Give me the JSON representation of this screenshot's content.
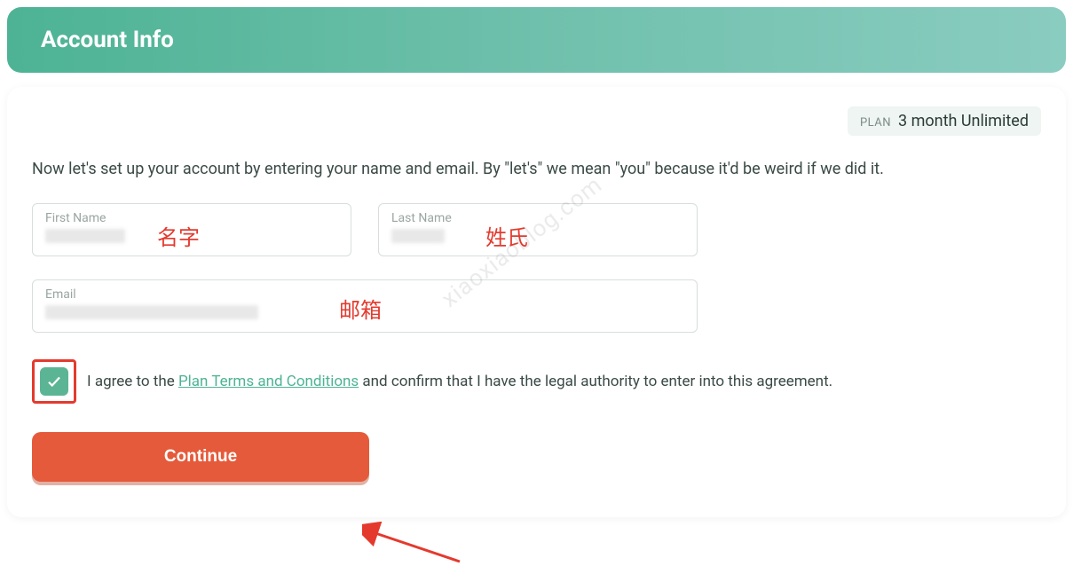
{
  "header": {
    "title": "Account Info"
  },
  "plan": {
    "label": "PLAN",
    "value": "3 month Unlimited"
  },
  "intro": "Now let's set up your account by entering your name and email. By \"let's\" we mean \"you\" because it'd be weird if we did it.",
  "fields": {
    "first_name": {
      "label": "First Name",
      "value": ""
    },
    "last_name": {
      "label": "Last Name",
      "value": ""
    },
    "email": {
      "label": "Email",
      "value": ""
    }
  },
  "annotations": {
    "first_name": "名字",
    "last_name": "姓氏",
    "email": "邮箱"
  },
  "watermark": "xiaoxiaoblog.com",
  "consent": {
    "prefix": "I agree to the ",
    "link": "Plan Terms and Conditions",
    "suffix": " and confirm that I have the legal authority to enter into this agreement.",
    "checked": true
  },
  "buttons": {
    "continue": "Continue"
  }
}
